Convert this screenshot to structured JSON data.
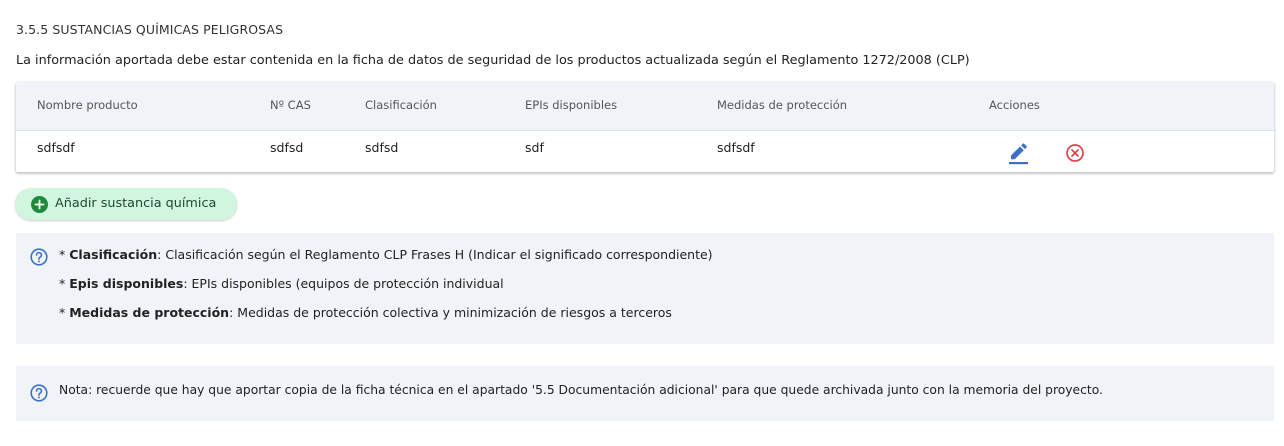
{
  "section": {
    "title": "3.5.5 SUSTANCIAS QUÍMICAS PELIGROSAS",
    "intro": "La información aportada debe estar contenida en la ficha de datos de seguridad de los productos actualizada según el Reglamento 1272/2008 (CLP)"
  },
  "table": {
    "headers": {
      "product": "Nombre producto",
      "cas": "Nº CAS",
      "classification": "Clasificación",
      "epis": "EPIs disponibles",
      "measures": "Medidas de protección",
      "actions": "Acciones"
    },
    "rows": [
      {
        "product": "sdfsdf",
        "cas": "sdfsd",
        "classification": "sdfsd",
        "epis": "sdf",
        "measures": "sdfsdf"
      }
    ]
  },
  "add_button": {
    "label": "Añadir sustancia química"
  },
  "info": {
    "line1": {
      "term": "Clasificación",
      "text": ": Clasificación según el Reglamento CLP Frases H (Indicar el significado correspondiente)"
    },
    "line2": {
      "term": "Epis disponibles",
      "text": ": EPIs disponibles (equipos de protección individual"
    },
    "line3": {
      "term": "Medidas de protección",
      "text": ": Medidas de protección colectiva y minimización de riesgos a terceros"
    },
    "bullet": "* "
  },
  "note": {
    "text": "Nota: recuerde que hay que aportar copia de la ficha técnica en el apartado '5.5 Documentación adicional' para que quede archivada junto con la memoria del proyecto."
  },
  "icons": {
    "edit": "pencil-icon",
    "delete": "close-circle-icon",
    "add": "plus-circle-icon",
    "help": "question-circle-icon"
  },
  "colors": {
    "edit": "#3f6fc8",
    "delete": "#e0434b",
    "add_bg": "#d2f5df",
    "add_icon": "#1e8b3a",
    "help": "#3f6fc8",
    "panel_bg": "#f0f3f7"
  }
}
